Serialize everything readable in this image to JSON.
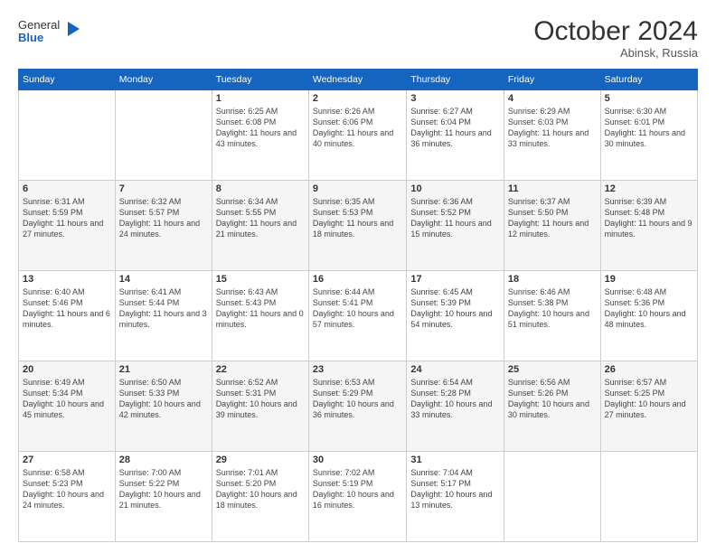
{
  "header": {
    "logo_general": "General",
    "logo_blue": "Blue",
    "month": "October 2024",
    "location": "Abinsk, Russia"
  },
  "days_of_week": [
    "Sunday",
    "Monday",
    "Tuesday",
    "Wednesday",
    "Thursday",
    "Friday",
    "Saturday"
  ],
  "weeks": [
    [
      {
        "day": "",
        "detail": ""
      },
      {
        "day": "",
        "detail": ""
      },
      {
        "day": "1",
        "detail": "Sunrise: 6:25 AM\nSunset: 6:08 PM\nDaylight: 11 hours and 43 minutes."
      },
      {
        "day": "2",
        "detail": "Sunrise: 6:26 AM\nSunset: 6:06 PM\nDaylight: 11 hours and 40 minutes."
      },
      {
        "day": "3",
        "detail": "Sunrise: 6:27 AM\nSunset: 6:04 PM\nDaylight: 11 hours and 36 minutes."
      },
      {
        "day": "4",
        "detail": "Sunrise: 6:29 AM\nSunset: 6:03 PM\nDaylight: 11 hours and 33 minutes."
      },
      {
        "day": "5",
        "detail": "Sunrise: 6:30 AM\nSunset: 6:01 PM\nDaylight: 11 hours and 30 minutes."
      }
    ],
    [
      {
        "day": "6",
        "detail": "Sunrise: 6:31 AM\nSunset: 5:59 PM\nDaylight: 11 hours and 27 minutes."
      },
      {
        "day": "7",
        "detail": "Sunrise: 6:32 AM\nSunset: 5:57 PM\nDaylight: 11 hours and 24 minutes."
      },
      {
        "day": "8",
        "detail": "Sunrise: 6:34 AM\nSunset: 5:55 PM\nDaylight: 11 hours and 21 minutes."
      },
      {
        "day": "9",
        "detail": "Sunrise: 6:35 AM\nSunset: 5:53 PM\nDaylight: 11 hours and 18 minutes."
      },
      {
        "day": "10",
        "detail": "Sunrise: 6:36 AM\nSunset: 5:52 PM\nDaylight: 11 hours and 15 minutes."
      },
      {
        "day": "11",
        "detail": "Sunrise: 6:37 AM\nSunset: 5:50 PM\nDaylight: 11 hours and 12 minutes."
      },
      {
        "day": "12",
        "detail": "Sunrise: 6:39 AM\nSunset: 5:48 PM\nDaylight: 11 hours and 9 minutes."
      }
    ],
    [
      {
        "day": "13",
        "detail": "Sunrise: 6:40 AM\nSunset: 5:46 PM\nDaylight: 11 hours and 6 minutes."
      },
      {
        "day": "14",
        "detail": "Sunrise: 6:41 AM\nSunset: 5:44 PM\nDaylight: 11 hours and 3 minutes."
      },
      {
        "day": "15",
        "detail": "Sunrise: 6:43 AM\nSunset: 5:43 PM\nDaylight: 11 hours and 0 minutes."
      },
      {
        "day": "16",
        "detail": "Sunrise: 6:44 AM\nSunset: 5:41 PM\nDaylight: 10 hours and 57 minutes."
      },
      {
        "day": "17",
        "detail": "Sunrise: 6:45 AM\nSunset: 5:39 PM\nDaylight: 10 hours and 54 minutes."
      },
      {
        "day": "18",
        "detail": "Sunrise: 6:46 AM\nSunset: 5:38 PM\nDaylight: 10 hours and 51 minutes."
      },
      {
        "day": "19",
        "detail": "Sunrise: 6:48 AM\nSunset: 5:36 PM\nDaylight: 10 hours and 48 minutes."
      }
    ],
    [
      {
        "day": "20",
        "detail": "Sunrise: 6:49 AM\nSunset: 5:34 PM\nDaylight: 10 hours and 45 minutes."
      },
      {
        "day": "21",
        "detail": "Sunrise: 6:50 AM\nSunset: 5:33 PM\nDaylight: 10 hours and 42 minutes."
      },
      {
        "day": "22",
        "detail": "Sunrise: 6:52 AM\nSunset: 5:31 PM\nDaylight: 10 hours and 39 minutes."
      },
      {
        "day": "23",
        "detail": "Sunrise: 6:53 AM\nSunset: 5:29 PM\nDaylight: 10 hours and 36 minutes."
      },
      {
        "day": "24",
        "detail": "Sunrise: 6:54 AM\nSunset: 5:28 PM\nDaylight: 10 hours and 33 minutes."
      },
      {
        "day": "25",
        "detail": "Sunrise: 6:56 AM\nSunset: 5:26 PM\nDaylight: 10 hours and 30 minutes."
      },
      {
        "day": "26",
        "detail": "Sunrise: 6:57 AM\nSunset: 5:25 PM\nDaylight: 10 hours and 27 minutes."
      }
    ],
    [
      {
        "day": "27",
        "detail": "Sunrise: 6:58 AM\nSunset: 5:23 PM\nDaylight: 10 hours and 24 minutes."
      },
      {
        "day": "28",
        "detail": "Sunrise: 7:00 AM\nSunset: 5:22 PM\nDaylight: 10 hours and 21 minutes."
      },
      {
        "day": "29",
        "detail": "Sunrise: 7:01 AM\nSunset: 5:20 PM\nDaylight: 10 hours and 18 minutes."
      },
      {
        "day": "30",
        "detail": "Sunrise: 7:02 AM\nSunset: 5:19 PM\nDaylight: 10 hours and 16 minutes."
      },
      {
        "day": "31",
        "detail": "Sunrise: 7:04 AM\nSunset: 5:17 PM\nDaylight: 10 hours and 13 minutes."
      },
      {
        "day": "",
        "detail": ""
      },
      {
        "day": "",
        "detail": ""
      }
    ]
  ]
}
